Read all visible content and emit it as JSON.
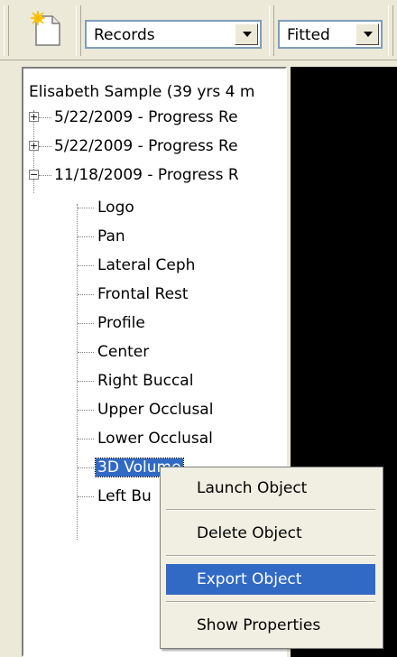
{
  "toolbar": {
    "new_icon": "new-document-icon",
    "records_select": "Records",
    "zoom_select": "Fitted"
  },
  "tree": {
    "root": "Elisabeth  Sample (39 yrs 4 m",
    "nodes": [
      {
        "label": "5/22/2009 - Progress Re",
        "expanded": false
      },
      {
        "label": "5/22/2009 - Progress Re",
        "expanded": false
      },
      {
        "label": "11/18/2009 - Progress R",
        "expanded": true
      }
    ],
    "children": [
      "Logo",
      "Pan",
      "Lateral Ceph",
      "Frontal Rest",
      "Profile",
      "Center",
      "Right Buccal",
      "Upper Occlusal",
      "Lower Occlusal",
      "3D Volume",
      "Left Bu"
    ],
    "selected_index": 9
  },
  "context_menu": {
    "items": [
      "Launch Object",
      "Delete Object",
      "Export Object",
      "Show Properties"
    ],
    "highlighted_index": 2
  },
  "colors": {
    "selection": "#316ac5",
    "face": "#ece9d8",
    "viewer": "#000000"
  }
}
